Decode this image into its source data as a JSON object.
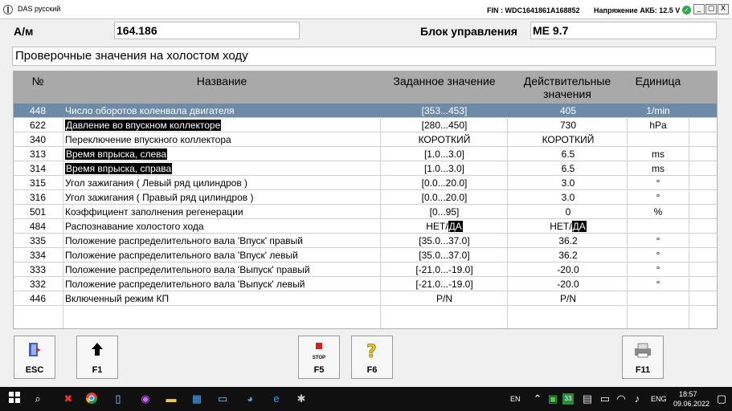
{
  "window": {
    "title": "DAS русский",
    "fin": "FIN : WDC1641861A168852",
    "battery": "Напряжение АКБ: 12.5 V",
    "buttons": [
      "_",
      "▢",
      "X"
    ]
  },
  "header": {
    "am_label": "А/м",
    "am_value": "164.186",
    "ecu_label": "Блок управления",
    "ecu_value": "ME 9.7"
  },
  "section_title": "Проверочные значения на холостом ходу",
  "table": {
    "columns": {
      "no": "№",
      "name": "Название",
      "set": "Заданное значение",
      "act_line1": "Действительные",
      "act_line2": "значения",
      "unit": "Единица"
    },
    "rows": [
      {
        "no": "448",
        "name": "Число оборотов коленвала двигателя",
        "set": "[353...453]",
        "act": "405",
        "unit": "1/min"
      },
      {
        "no": "622",
        "name": "Давление во впускном коллекторе",
        "set": "[280...450]",
        "act": "730",
        "unit": "hPa"
      },
      {
        "no": "340",
        "name": "Переключение впускного коллектора",
        "set": "КОРОТКИЙ",
        "act": "КОРОТКИЙ",
        "unit": ""
      },
      {
        "no": "313",
        "name": "Время впрыска, слева",
        "set": "[1.0...3.0]",
        "act": "6.5",
        "unit": "ms"
      },
      {
        "no": "314",
        "name": "Время впрыска, справа",
        "set": "[1.0...3.0]",
        "act": "6.5",
        "unit": "ms"
      },
      {
        "no": "315",
        "name": "Угол зажигания ( Левый ряд цилиндров )",
        "set": "[0.0...20.0]",
        "act": "3.0",
        "unit": "°"
      },
      {
        "no": "316",
        "name": "Угол зажигания ( Правый ряд цилиндров )",
        "set": "[0.0...20.0]",
        "act": "3.0",
        "unit": "°"
      },
      {
        "no": "501",
        "name": "Коэффициент заполнения регенерации",
        "set": "[0...95]",
        "act": "0",
        "unit": "%"
      },
      {
        "no": "484",
        "name": "Распознавание холостого хода",
        "set_a": "НЕТ/",
        "set_b": "ДА",
        "act_a": "НЕТ/",
        "act_b": "ДА",
        "unit": ""
      },
      {
        "no": "335",
        "name": "Положение распределительного вала 'Впуск' правый",
        "set": "[35.0...37.0]",
        "act": "36.2",
        "unit": "°"
      },
      {
        "no": "334",
        "name": "Положение распределительного вала 'Впуск' левый",
        "set": "[35.0...37.0]",
        "act": "36.2",
        "unit": "°"
      },
      {
        "no": "333",
        "name": "Положение распределительного вала 'Выпуск' правый",
        "set": "[-21.0...-19.0]",
        "act": "-20.0",
        "unit": "°"
      },
      {
        "no": "332",
        "name": "Положение распределительного вала 'Выпуск' левый",
        "set": "[-21.0...-19.0]",
        "act": "-20.0",
        "unit": "°"
      },
      {
        "no": "446",
        "name": "Включенный режим КП",
        "set": "P/N",
        "act": "P/N",
        "unit": ""
      }
    ]
  },
  "fkeys": {
    "esc": "ESC",
    "f1": "F1",
    "f5": "F5",
    "stop": "STOP",
    "f6": "F6",
    "f11": "F11"
  },
  "taskbar": {
    "lang": "EN",
    "lang2": "ENG",
    "time": "18:57",
    "date": "09.06.2022",
    "tray_num": "33"
  },
  "colors": {
    "selected_row": "#6d8ba9",
    "header_bg": "#a9a9a9",
    "status_ok": "#2fa84f"
  }
}
